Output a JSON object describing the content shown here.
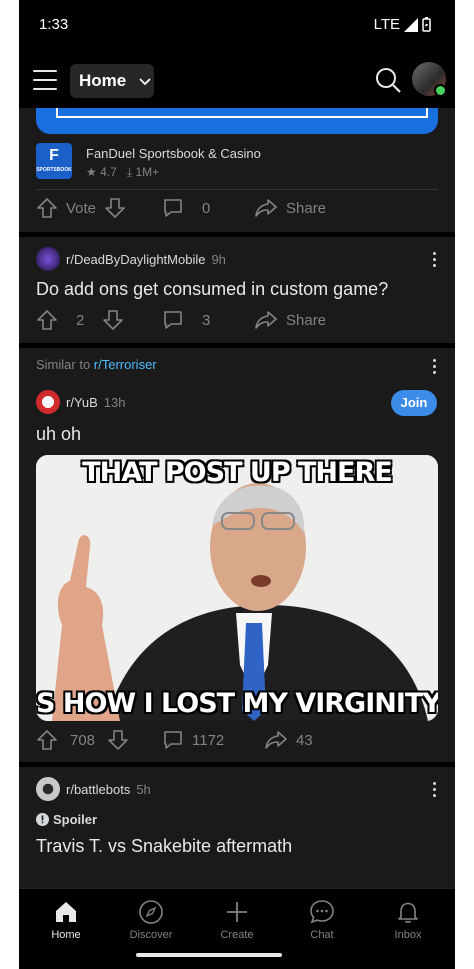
{
  "status_bar": {
    "time": "1:33",
    "network": "LTE"
  },
  "top_bar": {
    "feed_selector_label": "Home"
  },
  "ad_post": {
    "app_name": "FanDuel Sportsbook & Casino",
    "logo_text": "SPORTSBOOK",
    "rating": "4.7",
    "downloads": "1M+",
    "vote_label": "Vote",
    "comments": "0",
    "share_label": "Share"
  },
  "post1": {
    "subreddit": "r/DeadByDaylightMobile",
    "age": "9h",
    "title": "Do add ons get consumed in custom game?",
    "votes": "2",
    "comments": "3",
    "share_label": "Share"
  },
  "post2": {
    "similar_prefix": "Similar to ",
    "similar_sub": "r/Terroriser",
    "subreddit": "r/YuB",
    "age": "13h",
    "join_label": "Join",
    "title": "uh oh",
    "meme_top": "THAT POST UP THERE",
    "meme_bottom": "S HOW I LOST MY VIRGINITY",
    "votes": "708",
    "comments": "1172",
    "shares": "43"
  },
  "post3": {
    "subreddit": "r/battlebots",
    "age": "5h",
    "flair": "Spoiler",
    "title": "Travis T. vs Snakebite aftermath"
  },
  "bottom_nav": {
    "items": [
      {
        "label": "Home"
      },
      {
        "label": "Discover"
      },
      {
        "label": "Create"
      },
      {
        "label": "Chat"
      },
      {
        "label": "Inbox"
      }
    ]
  },
  "colors": {
    "background": "#000000",
    "card": "#1a1a1b",
    "accent_blue": "#3d8be8",
    "link_blue": "#4fbcff",
    "muted_text": "#818384"
  }
}
